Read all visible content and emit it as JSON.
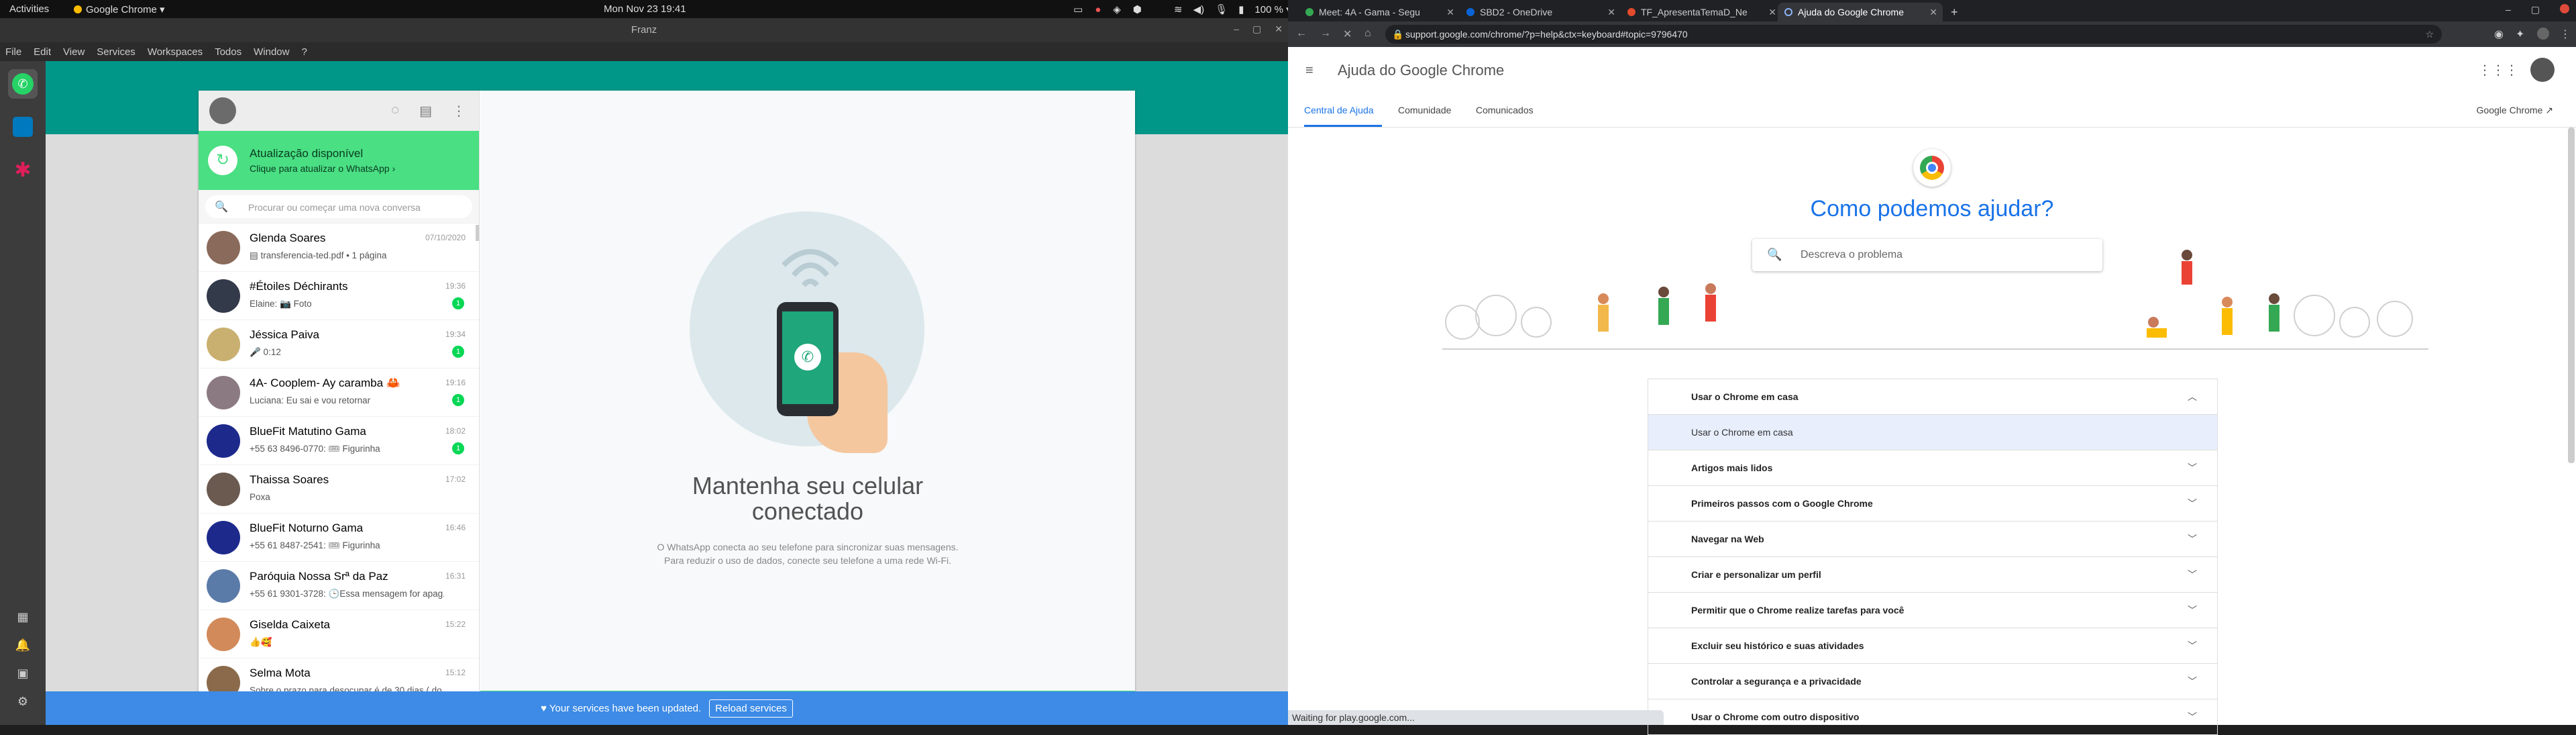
{
  "topbar": {
    "activities": "Activities",
    "app_name": "Google Chrome ▾",
    "clock": "Mon Nov 23  19:41",
    "volume_pct": "100 % ▾"
  },
  "franz": {
    "window_title": "Franz",
    "menu": [
      "File",
      "Edit",
      "View",
      "Services",
      "Workspaces",
      "Todos",
      "Window",
      "?"
    ]
  },
  "whatsapp": {
    "update_title": "Atualização disponível",
    "update_sub": "Clique para atualizar o WhatsApp ›",
    "search_placeholder": "Procurar ou começar uma nova conversa",
    "chats": [
      {
        "name": "Glenda Soares",
        "time": "07/10/2020",
        "msg": "▤ transferencia-ted.pdf • 1 página",
        "badge": "",
        "av": "#8a6a5a"
      },
      {
        "name": "#Étoiles Déchirants",
        "time": "19:36",
        "msg": "Elaine: 📷 Foto",
        "badge": "1",
        "av": "#333a4a"
      },
      {
        "name": "Jéssica Paiva",
        "time": "19:34",
        "msg": "🎤 0:12",
        "badge": "1",
        "av": "#c9b070"
      },
      {
        "name": "4A- Cooplem- Ay caramba 🦀",
        "time": "19:16",
        "msg": "Luciana: Eu sai e vou retornar",
        "badge": "1",
        "av": "#8c7a82"
      },
      {
        "name": "BlueFit Matutino Gama",
        "time": "18:02",
        "msg": "+55 63 8496-0770: 🎟 Figurinha",
        "badge": "1",
        "av": "#1d2a8c"
      },
      {
        "name": "Thaissa Soares",
        "time": "17:02",
        "msg": "Poxa",
        "badge": "",
        "av": "#6a5a50"
      },
      {
        "name": "BlueFit Noturno Gama",
        "time": "16:46",
        "msg": "+55 61 8487-2541: 🎟 Figurinha",
        "badge": "",
        "av": "#1d2a8c"
      },
      {
        "name": "Paróquia Nossa Srª da Paz",
        "time": "16:31",
        "msg": "+55 61 9301-3728: 🕒Essa mensagem for apag...",
        "badge": "",
        "av": "#5a7aa8"
      },
      {
        "name": "Giselda Caixeta",
        "time": "15:22",
        "msg": "👍🥰",
        "badge": "",
        "av": "#d28a5a"
      },
      {
        "name": "Selma Mota",
        "time": "15:12",
        "msg": "Sobre o prazo para desocupar é de 30 dias ( do...",
        "badge": "",
        "av": "#8a6a4a"
      }
    ],
    "main_title_1": "Mantenha seu celular",
    "main_title_2": "conectado",
    "desc_1": "O WhatsApp conecta ao seu telefone para sincronizar suas mensagens.",
    "desc_2": "Para reduzir o uso de dados, conecte seu telefone a uma rede Wi-Fi."
  },
  "notice": {
    "text": "♥ Your services have been updated.",
    "button": "Reload services"
  },
  "chrome": {
    "tabs": [
      {
        "title": "Meet: 4A - Gama - Segu",
        "active": false
      },
      {
        "title": "SBD2 - OneDrive",
        "active": false
      },
      {
        "title": "TF_ApresentaTemaD_Ne",
        "active": false
      },
      {
        "title": "Ajuda do Google Chrome",
        "active": true
      }
    ],
    "url": "support.google.com/chrome/?p=help&ctx=keyboard#topic=9796470",
    "page_title": "Ajuda do Google Chrome",
    "subnav": [
      "Central de Ajuda",
      "Comunidade",
      "Comunicados"
    ],
    "subnav_right": "Google Chrome",
    "headline": "Como podemos ajudar?",
    "search_placeholder": "Descreva o problema",
    "faq_open": "Usar o Chrome em casa",
    "faq_sub": "Usar o Chrome em casa",
    "faq": [
      "Artigos mais lidos",
      "Primeiros passos com o Google Chrome",
      "Navegar na Web",
      "Criar e personalizar um perfil",
      "Permitir que o Chrome realize tarefas para você",
      "Excluir seu histórico e suas atividades",
      "Controlar a segurança e a privacidade",
      "Usar o Chrome com outro dispositivo"
    ],
    "status": "Waiting for play.google.com..."
  }
}
